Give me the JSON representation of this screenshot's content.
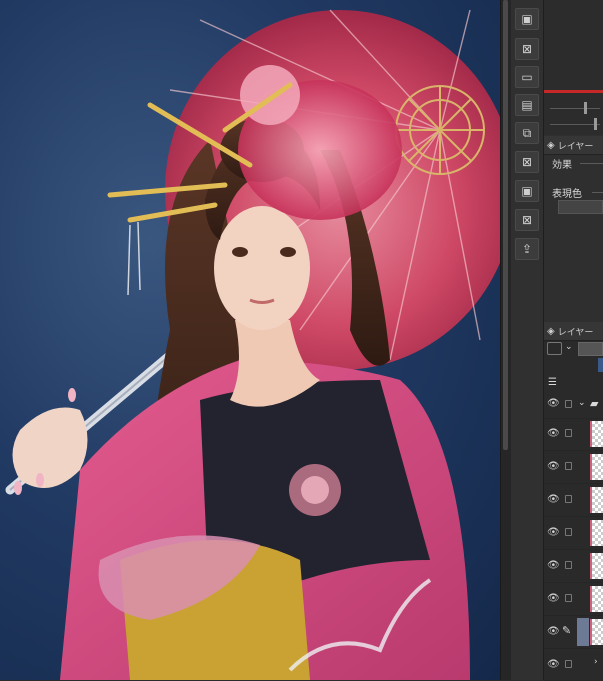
{
  "panels": {
    "layer_property_title": "レイヤー",
    "effect_label": "効果",
    "expression_color_label": "表現色",
    "layer_panel_title": "レイヤー"
  },
  "icons": {
    "eye": "eye-icon",
    "pen": "pen-icon",
    "folder": "folder-icon",
    "layers": "layers-icon"
  },
  "colors": {
    "accent_red": "#c62828",
    "selected_row": "#6c7a96",
    "umbrella": "#d9506b"
  }
}
